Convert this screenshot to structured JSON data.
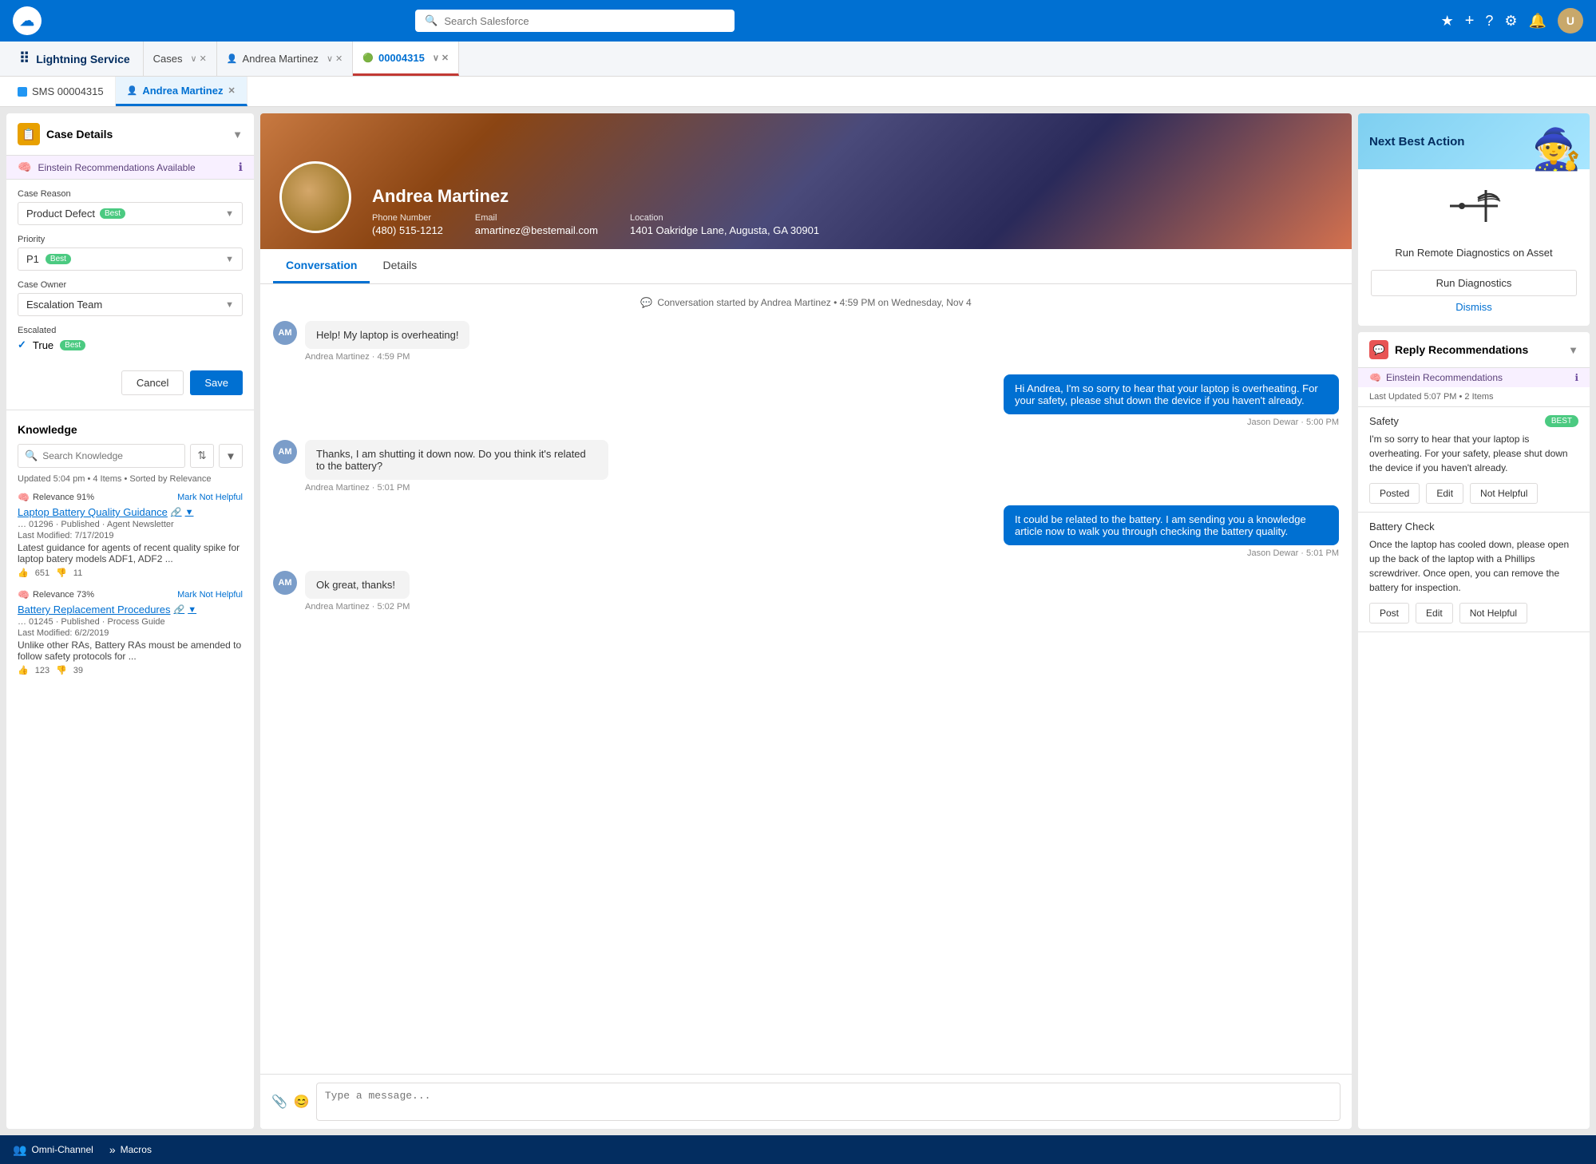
{
  "topNav": {
    "logoText": "☁",
    "searchPlaceholder": "Search Salesforce",
    "appName": "Lightning Service",
    "tabs": [
      {
        "label": "Cases",
        "active": false,
        "closeable": true
      },
      {
        "label": "Andrea Martinez",
        "active": false,
        "closeable": true,
        "icon": "👤"
      },
      {
        "label": "00004315",
        "active": true,
        "closeable": true,
        "icon": "🟢"
      }
    ]
  },
  "subtabs": [
    {
      "label": "SMS 00004315",
      "active": false,
      "type": "sms"
    },
    {
      "label": "Andrea Martinez",
      "active": true,
      "type": "contact",
      "closeable": true
    }
  ],
  "leftPanel": {
    "title": "Case Details",
    "einsteinText": "Einstein Recommendations Available",
    "fields": {
      "caseReasonLabel": "Case Reason",
      "caseReasonValue": "Product Defect",
      "caseReasonBest": "Best",
      "priorityLabel": "Priority",
      "priorityValue": "P1",
      "priorityBest": "Best",
      "caseOwnerLabel": "Case Owner",
      "caseOwnerValue": "Escalation Team",
      "escalatedLabel": "Escalated",
      "escalatedValue": "True",
      "escalatedBest": "Best"
    },
    "cancelLabel": "Cancel",
    "saveLabel": "Save"
  },
  "knowledge": {
    "title": "Knowledge",
    "searchPlaceholder": "Search Knowledge",
    "meta": "Updated 5:04 pm • 4 Items • Sorted by Relevance",
    "items": [
      {
        "relevance": "Relevance 91%",
        "markNotHelpful": "Mark Not Helpful",
        "title": "Laptop Battery Quality Guidance",
        "meta": "… 01296 · Published · Agent Newsletter",
        "lastModified": "Last Modified: 7/17/2019",
        "desc": "Latest guidance for agents of recent quality spike for laptop batery models ADF1, ADF2 ...",
        "upvotes": "651",
        "downvotes": "11"
      },
      {
        "relevance": "Relevance 73%",
        "markNotHelpful": "Mark Not Helpful",
        "title": "Battery Replacement Procedures",
        "meta": "… 01245 · Published · Process Guide",
        "lastModified": "Last Modified: 6/2/2019",
        "desc": "Unlike other RAs, Battery RAs moust be amended to follow safety protocols for ...",
        "upvotes": "123",
        "downvotes": "39"
      }
    ]
  },
  "profile": {
    "name": "Andrea Martinez",
    "phoneLabel": "Phone Number",
    "phoneValue": "(480) 515-1212",
    "emailLabel": "Email",
    "emailValue": "amartinez@bestemail.com",
    "locationLabel": "Location",
    "locationValue": "1401 Oakridge Lane, Augusta, GA 30901"
  },
  "conversation": {
    "tabs": [
      "Conversation",
      "Details"
    ],
    "activeTab": "Conversation",
    "systemMsg": "Conversation started by Andrea Martinez • 4:59 PM on Wednesday, Nov 4",
    "messages": [
      {
        "type": "left",
        "initials": "AM",
        "text": "Help!  My laptop is overheating!",
        "sender": "Andrea Martinez",
        "time": "4:59 PM"
      },
      {
        "type": "right",
        "text": "Hi Andrea, I'm so sorry to hear that your laptop is overheating.  For your safety, please shut down the device if you haven't already.",
        "sender": "Jason Dewar",
        "time": "5:00 PM"
      },
      {
        "type": "left",
        "initials": "AM",
        "text": "Thanks, I am shutting it down now.  Do you think it's related to the battery?",
        "sender": "Andrea Martinez",
        "time": "5:01 PM"
      },
      {
        "type": "right",
        "text": "It could be related to the battery.  I am sending you a knowledge article now to walk you through checking the battery quality.",
        "sender": "Jason Dewar",
        "time": "5:01 PM"
      },
      {
        "type": "left",
        "initials": "AM",
        "text": "Ok great, thanks!",
        "sender": "Andrea Martinez",
        "time": "5:02 PM"
      }
    ]
  },
  "nextBestAction": {
    "title": "Next Best Action",
    "description": "Run Remote Diagnostics on Asset",
    "runButton": "Run Diagnostics",
    "dismissButton": "Dismiss"
  },
  "replyRecommendations": {
    "title": "Reply Recommendations",
    "einsteinText": "Einstein Recommendations",
    "meta": "Last Updated 5:07 PM • 2 Items",
    "items": [
      {
        "label": "Safety",
        "badge": "BEST",
        "text": "I'm so sorry to hear that your laptop is overheating. For your safety, please shut down the device if you haven't already.",
        "actions": [
          "Posted",
          "Edit",
          "Not Helpful"
        ]
      },
      {
        "label": "Battery Check",
        "badge": null,
        "text": "Once the laptop has cooled down, please open up the back of the laptop with a Phillips screwdriver.  Once open, you can remove the battery for inspection.",
        "actions": [
          "Post",
          "Edit",
          "Not Helpful"
        ]
      }
    ]
  },
  "bottomBar": {
    "items": [
      {
        "icon": "👥",
        "label": "Omni-Channel"
      },
      {
        "icon": "»",
        "label": "Macros"
      }
    ]
  }
}
